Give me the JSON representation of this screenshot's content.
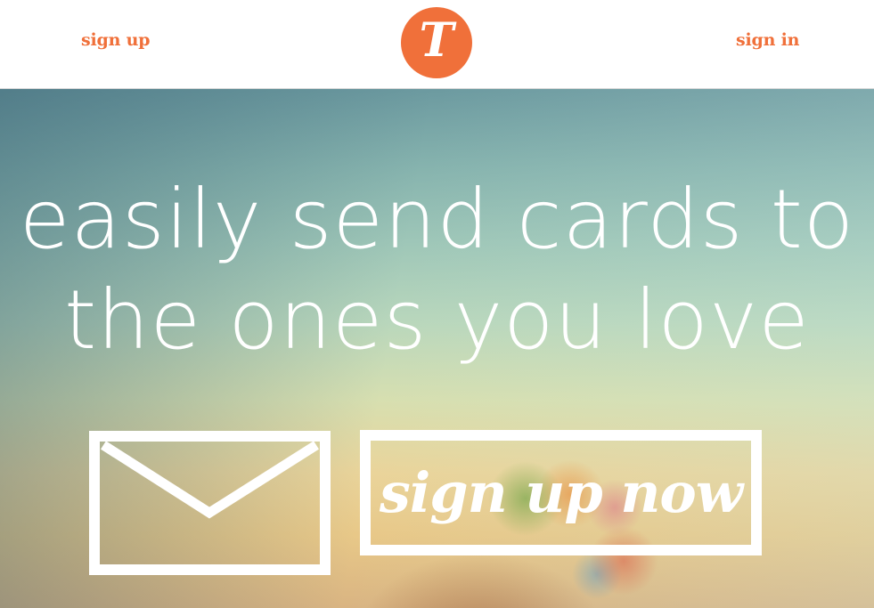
{
  "header": {
    "signup_label": "sign up",
    "signin_label": "sign in",
    "logo_letter": "T"
  },
  "hero": {
    "headline_line1": "easily send cards to",
    "headline_line2": "the ones you love",
    "cta_label": "sign up now"
  },
  "colors": {
    "brand_orange": "#f0703a",
    "text_white": "#ffffff"
  },
  "icons": {
    "logo": "logo-badge-icon",
    "email": "envelope-icon"
  }
}
